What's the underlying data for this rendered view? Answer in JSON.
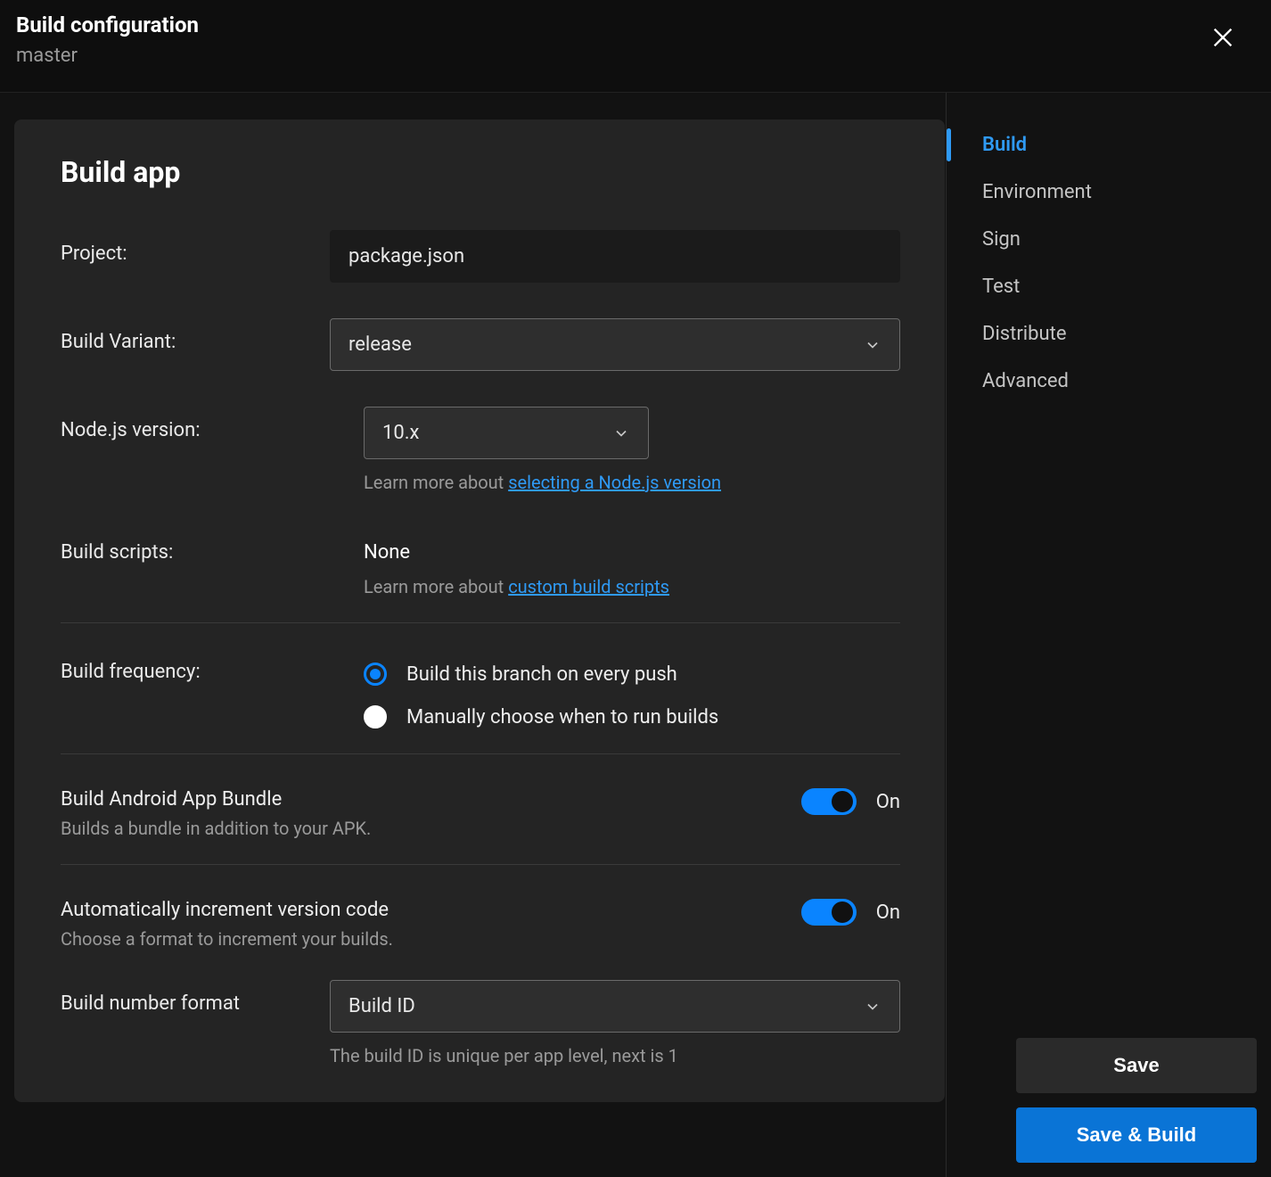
{
  "header": {
    "title": "Build configuration",
    "subtitle": "master"
  },
  "panel": {
    "title": "Build app",
    "project": {
      "label": "Project:",
      "value": "package.json"
    },
    "buildVariant": {
      "label": "Build Variant:",
      "value": "release"
    },
    "node": {
      "label": "Node.js version:",
      "value": "10.x",
      "helper_prefix": "Learn more about ",
      "helper_link": "selecting a Node.js version"
    },
    "scripts": {
      "label": "Build scripts:",
      "value": "None",
      "helper_prefix": "Learn more about ",
      "helper_link": "custom build scripts"
    },
    "frequency": {
      "label": "Build frequency:",
      "opt1": "Build this branch on every push",
      "opt2": "Manually choose when to run builds"
    },
    "bundle": {
      "title": "Build Android App Bundle",
      "sub": "Builds a bundle in addition to your APK.",
      "state": "On"
    },
    "increment": {
      "title": "Automatically increment version code",
      "sub": "Choose a format to increment your builds.",
      "state": "On"
    },
    "buildNumber": {
      "label": "Build number format",
      "value": "Build ID",
      "helper": "The build ID is unique per app level, next is 1"
    }
  },
  "nav": {
    "items": [
      "Build",
      "Environment",
      "Sign",
      "Test",
      "Distribute",
      "Advanced"
    ]
  },
  "buttons": {
    "save": "Save",
    "saveBuild": "Save & Build"
  }
}
